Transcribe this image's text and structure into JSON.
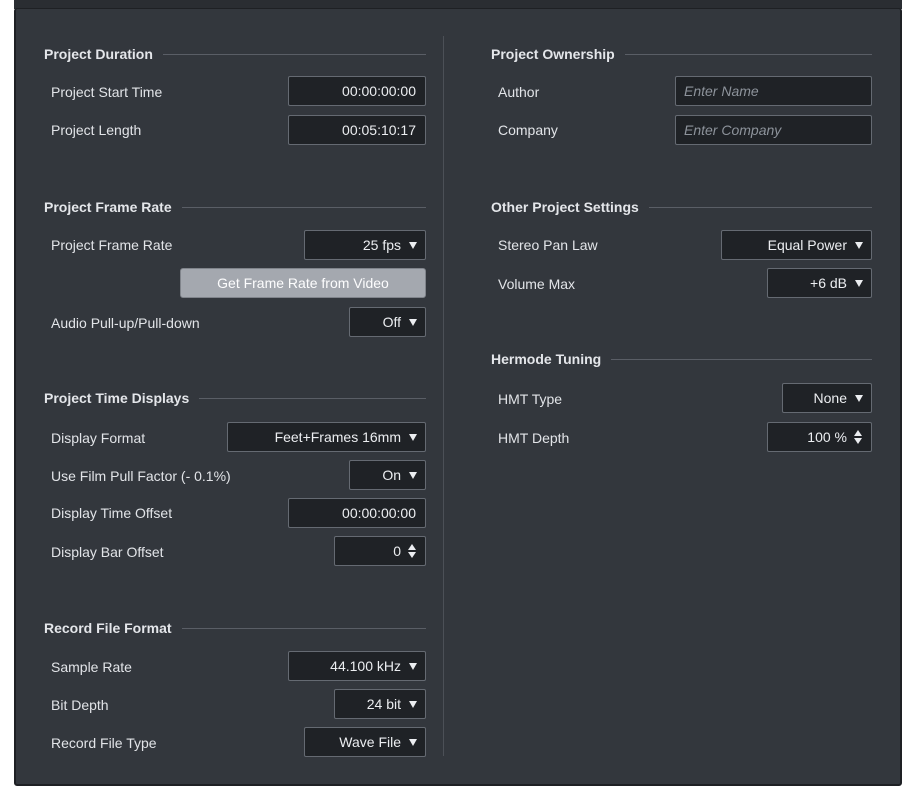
{
  "left": {
    "project_duration": {
      "title": "Project Duration",
      "start_time_label": "Project Start Time",
      "start_time_value": "00:00:00:00",
      "length_label": "Project Length",
      "length_value": "00:05:10:17"
    },
    "frame_rate": {
      "title": "Project Frame Rate",
      "rate_label": "Project Frame Rate",
      "rate_value": "25 fps",
      "get_from_video_label": "Get Frame Rate from Video",
      "pull_label": "Audio Pull-up/Pull-down",
      "pull_value": "Off"
    },
    "time_displays": {
      "title": "Project Time Displays",
      "format_label": "Display Format",
      "format_value": "Feet+Frames 16mm",
      "film_pull_label": "Use Film Pull Factor (- 0.1%)",
      "film_pull_value": "On",
      "time_offset_label": "Display Time Offset",
      "time_offset_value": "00:00:00:00",
      "bar_offset_label": "Display Bar Offset",
      "bar_offset_value": "0"
    },
    "record_format": {
      "title": "Record File Format",
      "sample_rate_label": "Sample Rate",
      "sample_rate_value": "44.100 kHz",
      "bit_depth_label": "Bit Depth",
      "bit_depth_value": "24 bit",
      "file_type_label": "Record File Type",
      "file_type_value": "Wave File"
    }
  },
  "right": {
    "ownership": {
      "title": "Project Ownership",
      "author_label": "Author",
      "author_placeholder": "Enter Name",
      "company_label": "Company",
      "company_placeholder": "Enter Company"
    },
    "other": {
      "title": "Other Project Settings",
      "pan_law_label": "Stereo Pan Law",
      "pan_law_value": "Equal Power",
      "volume_max_label": "Volume Max",
      "volume_max_value": "+6 dB"
    },
    "hermode": {
      "title": "Hermode Tuning",
      "hmt_type_label": "HMT Type",
      "hmt_type_value": "None",
      "hmt_depth_label": "HMT Depth",
      "hmt_depth_value": "100 %"
    }
  },
  "icons": {
    "dropdown_arrow": "triangle-down",
    "spinner": "up-down-arrows"
  },
  "colors": {
    "panel_bg": "#33373d",
    "field_bg": "#1f2226",
    "field_border": "#656a72",
    "button_bg": "#a4a8af",
    "text": "#e2e4e8"
  }
}
